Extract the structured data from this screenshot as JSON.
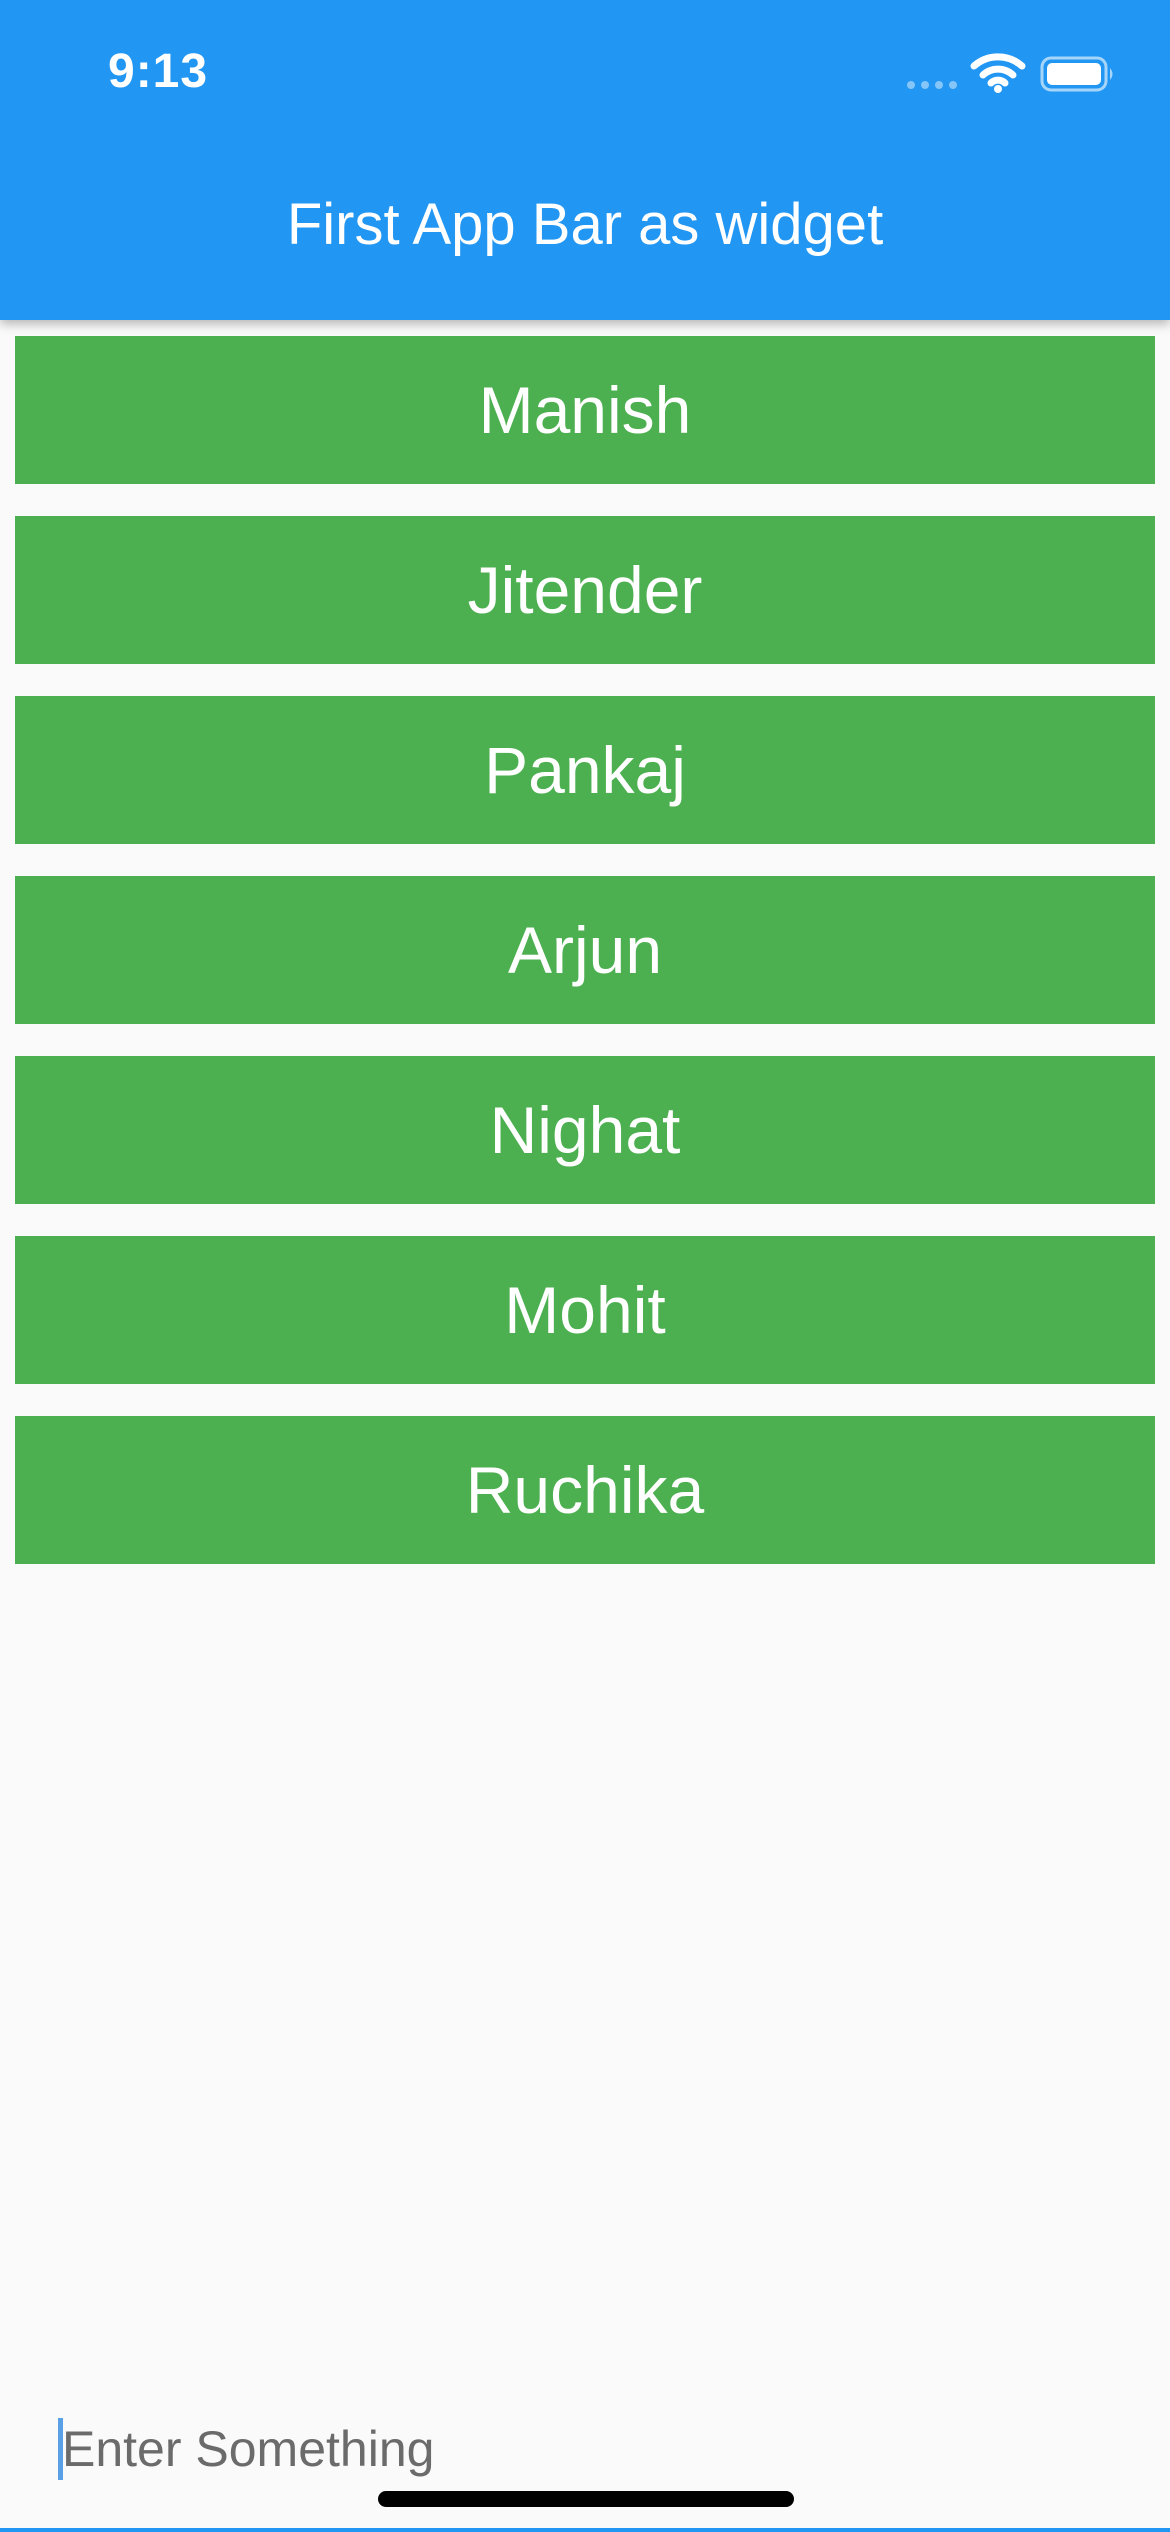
{
  "status_bar": {
    "time": "9:13"
  },
  "app_bar": {
    "title": "First App Bar as widget",
    "color": "#2196f3"
  },
  "list": {
    "color": "#4caf50",
    "items": [
      {
        "label": "Manish"
      },
      {
        "label": "Jitender"
      },
      {
        "label": "Pankaj"
      },
      {
        "label": "Arjun"
      },
      {
        "label": "Nighat"
      },
      {
        "label": "Mohit"
      },
      {
        "label": "Ruchika"
      }
    ]
  },
  "input": {
    "placeholder": "Enter Something",
    "value": ""
  },
  "icons": {
    "signal": "cellular-signal-icon",
    "wifi": "wifi-icon",
    "battery": "battery-icon"
  }
}
